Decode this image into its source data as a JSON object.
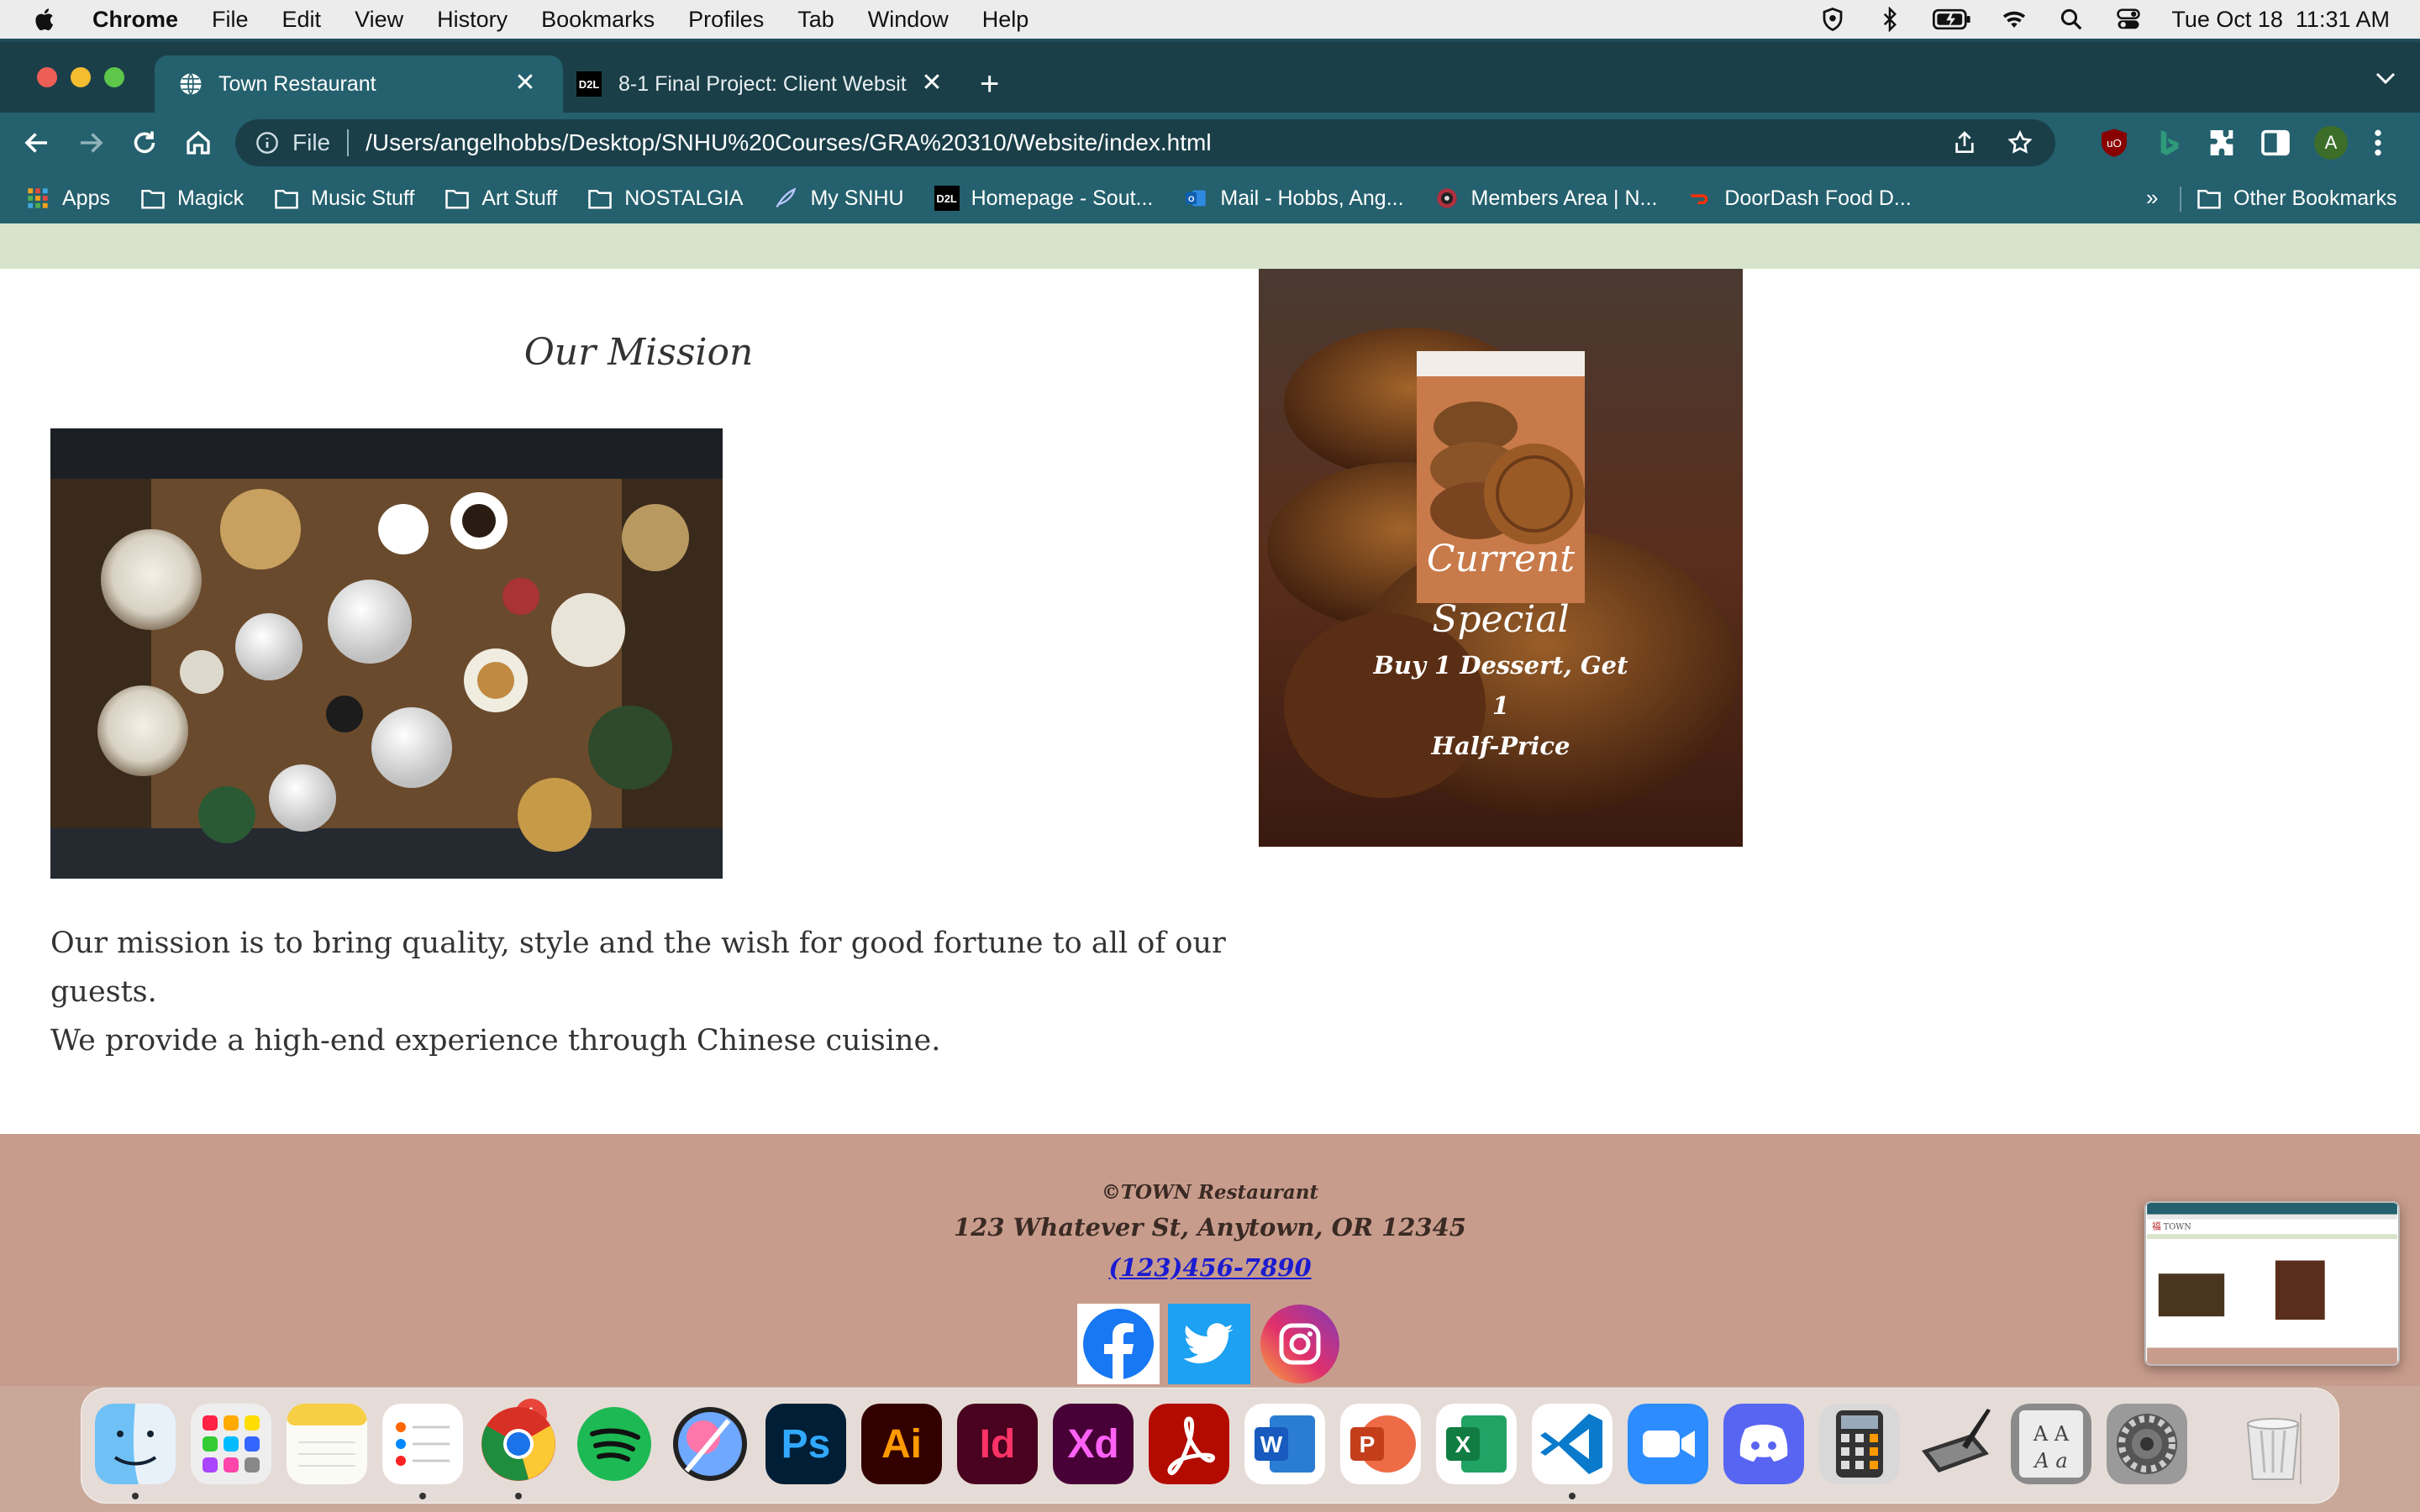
{
  "menubar": {
    "items": [
      "Chrome",
      "File",
      "Edit",
      "View",
      "History",
      "Bookmarks",
      "Profiles",
      "Tab",
      "Window",
      "Help"
    ],
    "clock": "Tue Oct 18  11:31 AM"
  },
  "tabs": [
    {
      "title": "Town Restaurant"
    },
    {
      "title": "8-1 Final Project: Client Websit"
    }
  ],
  "omnibox": {
    "scheme": "File",
    "url": "/Users/angelhobbs/Desktop/SNHU%20Courses/GRA%20310/Website/index.html"
  },
  "profile_initial": "A",
  "bookmarks": {
    "items": [
      "Apps",
      "Magick",
      "Music Stuff",
      "Art Stuff",
      "NOSTALGIA",
      "My SNHU",
      "Homepage - Sout...",
      "Mail - Hobbs, Ang...",
      "Members Area | N...",
      "DoorDash Food D..."
    ],
    "more": "»",
    "other": "Other Bookmarks"
  },
  "page": {
    "mission_title": "Our Mission",
    "mission_text_1": "Our mission is to bring quality, style and the wish for good fortune to all of our guests.",
    "mission_text_2": "We provide a high-end experience through Chinese cuisine.",
    "special_heading_1": "Current",
    "special_heading_2": "Special",
    "special_offer_1": "Buy 1 Dessert, Get 1",
    "special_offer_2": "Half-Price",
    "footer_copy": "©TOWN Restaurant",
    "footer_address": "123 Whatever St, Anytown, OR 12345",
    "footer_phone": "(123)456-7890"
  },
  "dock": {
    "badge": "1",
    "apps": [
      "finder",
      "launchpad",
      "notes",
      "reminders",
      "chrome",
      "spotify",
      "procreate",
      "photoshop",
      "illustrator",
      "indesign",
      "xd",
      "acrobat",
      "word",
      "powerpoint",
      "excel",
      "vscode",
      "zoom",
      "discord",
      "calculator",
      "pen-tablet",
      "font-book",
      "system-preferences",
      "trash"
    ],
    "labels": {
      "photoshop": "Ps",
      "illustrator": "Ai",
      "indesign": "Id",
      "xd": "Xd"
    }
  },
  "colors": {
    "tab_strip": "#1a3f49",
    "toolbar": "#24606d",
    "nav_strip": "#d7e4cb",
    "footer": "#c89c8c",
    "link": "#1b1bd0"
  }
}
